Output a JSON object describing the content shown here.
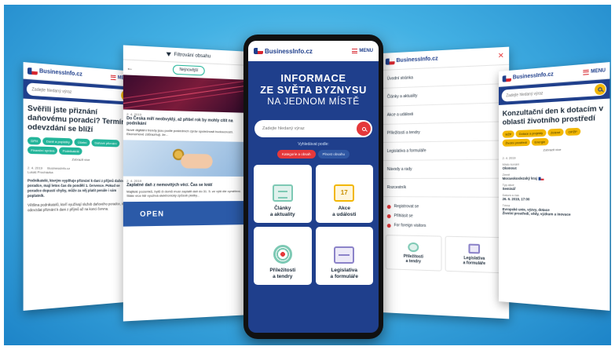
{
  "brand": {
    "logo": "BusinessInfo.cz",
    "menu": "MENU"
  },
  "search": {
    "placeholder": "Zadejte hledaný výraz"
  },
  "phone1": {
    "headline": "Svěřili jste přiznání daňovému poradci? Termín odevzdání se blíží",
    "tags": [
      "DPH",
      "Daně a poplatky",
      "Účetní",
      "Daňové přiznání",
      "Finanční správa",
      "Podnikatelé"
    ],
    "more": "Zobrazit více",
    "meta_date": "2. 4. 2019",
    "meta_source": "BusinessInfo.cz",
    "meta_author": "Lukáš Procházka",
    "para1": "Podnikatelé, kterým vyplňuje přiznání k dani z příjmů daňový poradce, mají letos čas do pondělí 1. července. Pokud se poradce dopustí chyby, může za něj platit penále i sám poplatník.",
    "para2": "Většina podnikatelů, kteří využívají služeb daňového poradce, může odevzdat přiznání k dani z příjmů až na konci června."
  },
  "phone2": {
    "filter": "Filtrování obsahu",
    "sort": "Nejnovější",
    "card1": {
      "date": "2. 4. 2019",
      "title": "Do Česka míří neobvyklý, až přišel rok by mohly cítit na podnikání",
      "text": "Nové digitální trendy jsou podle posledních zpráv společnosti budoucností. Ekonomové zdůrazňují, že..."
    },
    "card2": {
      "date": "2. 4. 2019",
      "title": "Zaplatné daň z nemovitých věcí. Čas se krátí",
      "text": "Majitelé pozemků, bytů či domů musí zaplatit daň do 31. 5. ve výši dle vyměření. Stále více lidí využívá elektronický způsob platby..."
    },
    "card3_img": "OPEN"
  },
  "phone3": {
    "hero_l1": "INFORMACE",
    "hero_l2": "ZE SVĚTA BYZNYSU",
    "hero_l3": "NA JEDNOM MÍSTĚ",
    "search_sub": "Vyhledávat podle:",
    "toggle_active": "Kategorie a obsah",
    "toggle_plain": "Plnost obsahu",
    "tiles": [
      {
        "label1": "Články",
        "label2": "a aktuality"
      },
      {
        "label1": "Akce",
        "label2": "a události"
      },
      {
        "label1": "Příležitosti",
        "label2": "a tendry"
      },
      {
        "label1": "Legislativa",
        "label2": "a formuláře"
      }
    ]
  },
  "phone4": {
    "menu_items": [
      "Úvodní stránka",
      "Články a aktuality",
      "Akce a události",
      "Příležitosti a tendry",
      "Legislativa a formuláře",
      "Návody a rady",
      "Rozcestník"
    ],
    "links": [
      "Registrovat se",
      "Přihlásit se",
      "For foreign visitors"
    ],
    "tiles": [
      {
        "label1": "Příležitosti",
        "label2": "a tendry"
      },
      {
        "label1": "Legislativa",
        "label2": "a formuláře"
      }
    ]
  },
  "phone5": {
    "headline": "Konzultační den k dotacím v oblasti životního prostředí",
    "tags": [
      "MŽP",
      "Dotace a projekty",
      "Zelené",
      "OPŽP",
      "Životní prostředí",
      "Energie"
    ],
    "more": "Zobrazit více",
    "date_label": "2. 4. 2019",
    "place_label": "Místo konání",
    "place_value": "Olomouc",
    "country_label": "Země",
    "country_value": "Moravskoslezský kraj",
    "type_label": "Typ akce",
    "type_value": "Seminář",
    "when_label": "Datum a čas",
    "when_value": "26. 6. 2019, 17:00",
    "topic_label": "Téma",
    "topic_value": "Evropské unie, výzvy, dotace",
    "topic_value2": "Životní prostředí, vědy, výzkum a inovace"
  },
  "colors": {
    "brand_blue": "#1f3f8c",
    "accent_red": "#e5383b",
    "teal": "#23b59a",
    "yellow": "#f2b705"
  }
}
